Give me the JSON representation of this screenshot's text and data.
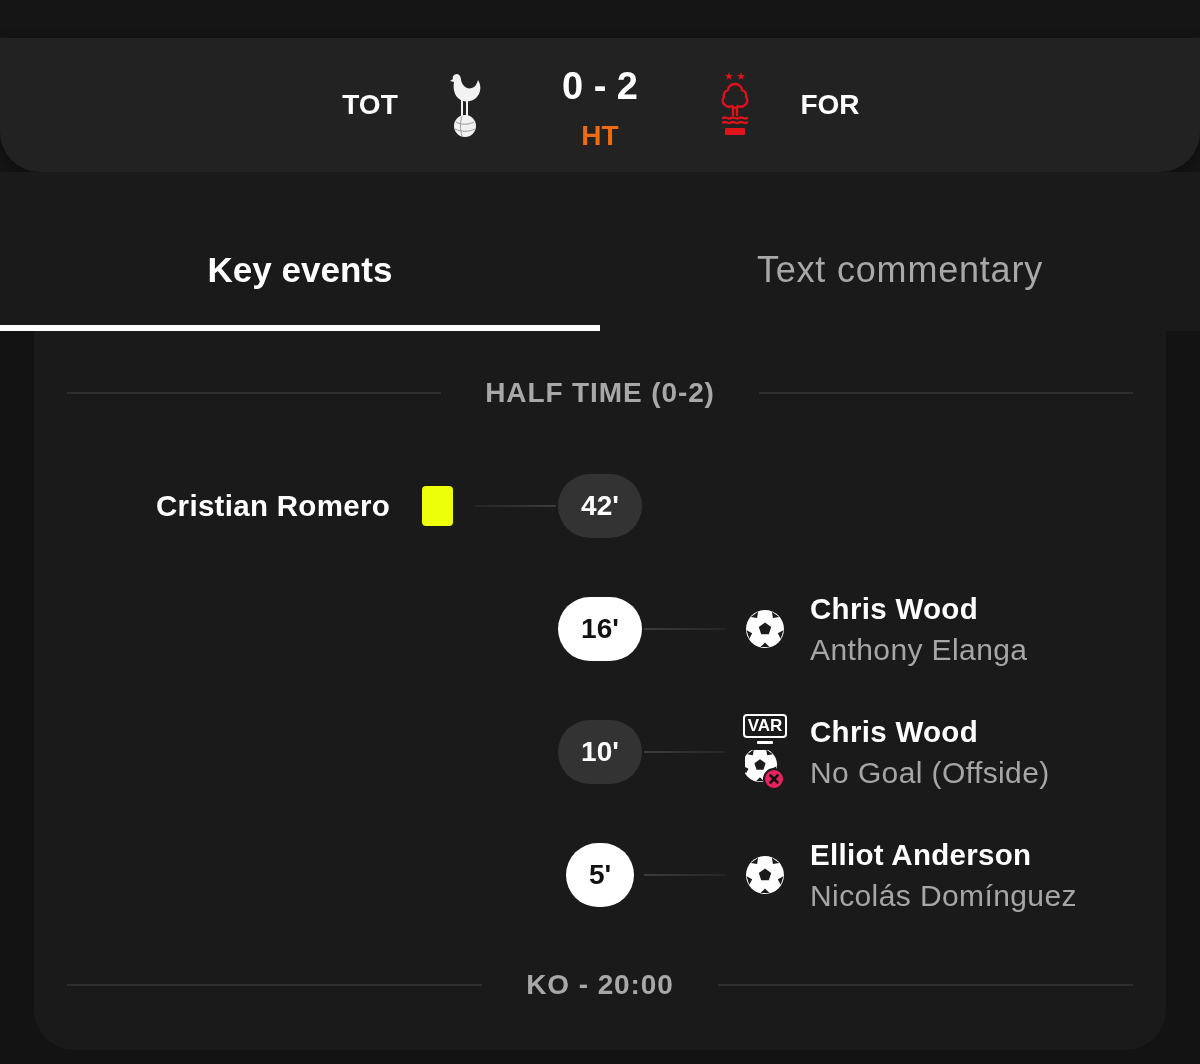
{
  "header": {
    "home": {
      "code": "TOT"
    },
    "score": "0 - 2",
    "status": "HT",
    "away": {
      "code": "FOR"
    }
  },
  "tabs": [
    {
      "label": "Key events",
      "selected": true
    },
    {
      "label": "Text commentary",
      "selected": false
    }
  ],
  "timeline": [
    {
      "kind": "divider",
      "label": "HALF TIME (0-2)"
    },
    {
      "kind": "yellow_card",
      "home_team": true,
      "minute": "42'",
      "player": "Cristian Romero"
    },
    {
      "kind": "goal",
      "home_team": false,
      "minute": "16'",
      "player": "Chris Wood",
      "detail": "Anthony Elanga"
    },
    {
      "kind": "var_no_goal",
      "home_team": false,
      "minute": "10'",
      "var_label": "VAR",
      "player": "Chris Wood",
      "detail": "No Goal (Offside)"
    },
    {
      "kind": "goal",
      "home_team": false,
      "minute": "5'",
      "player": "Elliot Anderson",
      "detail": "Nicolás Domínguez"
    },
    {
      "kind": "divider",
      "label": "KO - 20:00"
    }
  ]
}
